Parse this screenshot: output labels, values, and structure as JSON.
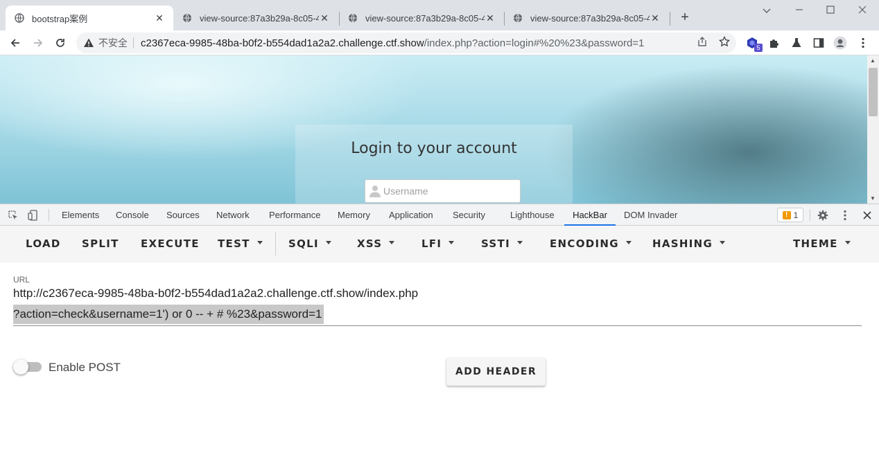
{
  "browser": {
    "tabs": [
      {
        "title": "bootstrap案例",
        "active": true
      },
      {
        "title": "view-source:87a3b29a-8c05-4",
        "active": false
      },
      {
        "title": "view-source:87a3b29a-8c05-4",
        "active": false
      },
      {
        "title": "view-source:87a3b29a-8c05-4",
        "active": false
      }
    ],
    "new_tab_label": "+",
    "security_label": "不安全",
    "url_host": "c2367eca-9985-48ba-b0f2-b554dad1a2a2.challenge.ctf.show",
    "url_path": "/index.php?action=login#%20%23&password=1",
    "extension_badge": "5"
  },
  "page": {
    "login_title": "Login to your account",
    "username_placeholder": "Username"
  },
  "devtools": {
    "tabs": [
      {
        "label": "Elements"
      },
      {
        "label": "Console"
      },
      {
        "label": "Sources"
      },
      {
        "label": "Network"
      },
      {
        "label": "Performance"
      },
      {
        "label": "Memory"
      },
      {
        "label": "Application"
      },
      {
        "label": "Security"
      },
      {
        "label": "Lighthouse"
      },
      {
        "label": "HackBar",
        "active": true
      },
      {
        "label": "DOM Invader"
      }
    ],
    "issues_count": "1"
  },
  "hackbar": {
    "buttons": {
      "load": "LOAD",
      "split": "SPLIT",
      "execute": "EXECUTE",
      "test": "TEST",
      "sqli": "SQLI",
      "xss": "XSS",
      "lfi": "LFI",
      "ssti": "SSTI",
      "encoding": "ENCODING",
      "hashing": "HASHING",
      "theme": "THEME"
    },
    "url_label": "URL",
    "url_line1": "http://c2367eca-9985-48ba-b0f2-b554dad1a2a2.challenge.ctf.show/index.php",
    "url_line2": "?action=check&username=1') or 0 -- + # %23&password=1",
    "enable_post_label": "Enable POST",
    "enable_post": false,
    "add_header_label": "ADD HEADER"
  },
  "colors": {
    "accent": "#1a73e8",
    "issues_flag": "#f29900",
    "extension_badge": "#5b4fcf"
  }
}
